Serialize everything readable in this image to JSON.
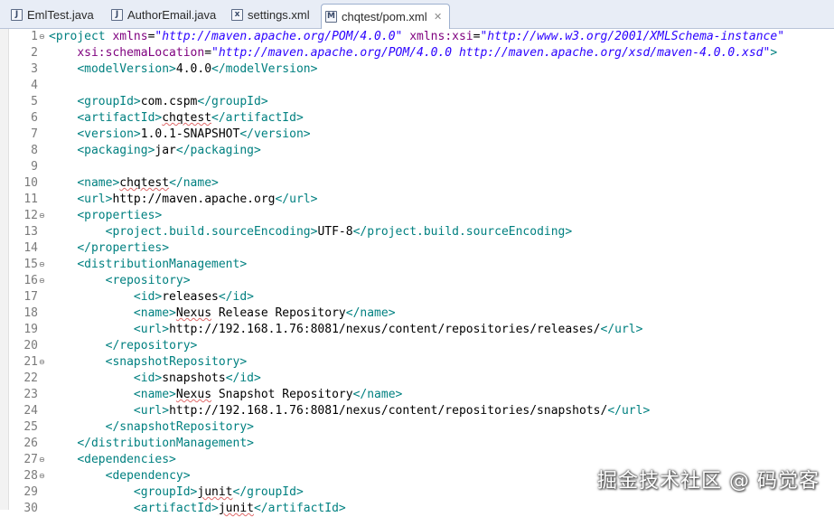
{
  "tabs": [
    {
      "label": "EmlTest.java",
      "icon": "java-file-icon",
      "glyph": "J",
      "active": false
    },
    {
      "label": "AuthorEmail.java",
      "icon": "java-file-icon",
      "glyph": "J",
      "active": false
    },
    {
      "label": "settings.xml",
      "icon": "xml-file-icon",
      "glyph": "x",
      "active": false
    },
    {
      "label": "chqtest/pom.xml",
      "icon": "maven-pom-icon",
      "glyph": "M",
      "active": true
    }
  ],
  "close_glyph": "✕",
  "editor": {
    "lines": [
      {
        "n": "1",
        "fold": true,
        "indent": "",
        "segs": [
          [
            "t",
            "<project "
          ],
          [
            "a",
            "xmlns"
          ],
          [
            "p",
            "="
          ],
          [
            "v",
            "\"http://maven.apache.org/POM/4.0.0\""
          ],
          [
            "p",
            " "
          ],
          [
            "a",
            "xmlns:xsi"
          ],
          [
            "p",
            "="
          ],
          [
            "v",
            "\"http://www.w3.org/2001/XMLSchema-instance\""
          ]
        ]
      },
      {
        "n": "2",
        "fold": false,
        "indent": "    ",
        "segs": [
          [
            "a",
            "xsi:schemaLocation"
          ],
          [
            "p",
            "="
          ],
          [
            "v",
            "\"http://maven.apache.org/POM/4.0.0 http://maven.apache.org/xsd/maven-4.0.0.xsd\""
          ],
          [
            "t",
            ">"
          ]
        ]
      },
      {
        "n": "3",
        "fold": false,
        "indent": "    ",
        "segs": [
          [
            "t",
            "<modelVersion>"
          ],
          [
            "p",
            "4.0.0"
          ],
          [
            "t",
            "</modelVersion>"
          ]
        ]
      },
      {
        "n": "4",
        "fold": false,
        "indent": "",
        "segs": []
      },
      {
        "n": "5",
        "fold": false,
        "indent": "    ",
        "segs": [
          [
            "t",
            "<groupId>"
          ],
          [
            "p",
            "com.cspm"
          ],
          [
            "t",
            "</groupId>"
          ]
        ]
      },
      {
        "n": "6",
        "fold": false,
        "indent": "    ",
        "segs": [
          [
            "t",
            "<artifactId>"
          ],
          [
            "s",
            "chqtest"
          ],
          [
            "t",
            "</artifactId>"
          ]
        ]
      },
      {
        "n": "7",
        "fold": false,
        "indent": "    ",
        "segs": [
          [
            "t",
            "<version>"
          ],
          [
            "p",
            "1.0.1-SNAPSHOT"
          ],
          [
            "t",
            "</version>"
          ]
        ]
      },
      {
        "n": "8",
        "fold": false,
        "indent": "    ",
        "segs": [
          [
            "t",
            "<packaging>"
          ],
          [
            "p",
            "jar"
          ],
          [
            "t",
            "</packaging>"
          ]
        ]
      },
      {
        "n": "9",
        "fold": false,
        "indent": "",
        "segs": []
      },
      {
        "n": "10",
        "fold": false,
        "indent": "    ",
        "segs": [
          [
            "t",
            "<name>"
          ],
          [
            "s",
            "chqtest"
          ],
          [
            "t",
            "</name>"
          ]
        ]
      },
      {
        "n": "11",
        "fold": false,
        "indent": "    ",
        "segs": [
          [
            "t",
            "<url>"
          ],
          [
            "p",
            "http://maven.apache.org"
          ],
          [
            "t",
            "</url>"
          ]
        ]
      },
      {
        "n": "12",
        "fold": true,
        "indent": "    ",
        "segs": [
          [
            "t",
            "<properties>"
          ]
        ]
      },
      {
        "n": "13",
        "fold": false,
        "indent": "        ",
        "segs": [
          [
            "t",
            "<project.build.sourceEncoding>"
          ],
          [
            "p",
            "UTF-8"
          ],
          [
            "t",
            "</project.build.sourceEncoding>"
          ]
        ]
      },
      {
        "n": "14",
        "fold": false,
        "indent": "    ",
        "segs": [
          [
            "t",
            "</properties>"
          ]
        ]
      },
      {
        "n": "15",
        "fold": true,
        "indent": "    ",
        "segs": [
          [
            "t",
            "<distributionManagement>"
          ]
        ]
      },
      {
        "n": "16",
        "fold": true,
        "indent": "        ",
        "segs": [
          [
            "t",
            "<repository>"
          ]
        ]
      },
      {
        "n": "17",
        "fold": false,
        "indent": "            ",
        "segs": [
          [
            "t",
            "<id>"
          ],
          [
            "p",
            "releases"
          ],
          [
            "t",
            "</id>"
          ]
        ]
      },
      {
        "n": "18",
        "fold": false,
        "indent": "            ",
        "segs": [
          [
            "t",
            "<name>"
          ],
          [
            "s",
            "Nexus"
          ],
          [
            "p",
            " Release Repository"
          ],
          [
            "t",
            "</name>"
          ]
        ]
      },
      {
        "n": "19",
        "fold": false,
        "indent": "            ",
        "segs": [
          [
            "t",
            "<url>"
          ],
          [
            "p",
            "http://192.168.1.76:8081/nexus/content/repositories/releases/"
          ],
          [
            "t",
            "</url>"
          ]
        ]
      },
      {
        "n": "20",
        "fold": false,
        "indent": "        ",
        "segs": [
          [
            "t",
            "</repository>"
          ]
        ]
      },
      {
        "n": "21",
        "fold": true,
        "indent": "        ",
        "segs": [
          [
            "t",
            "<snapshotRepository>"
          ]
        ]
      },
      {
        "n": "22",
        "fold": false,
        "indent": "            ",
        "segs": [
          [
            "t",
            "<id>"
          ],
          [
            "p",
            "snapshots"
          ],
          [
            "t",
            "</id>"
          ]
        ]
      },
      {
        "n": "23",
        "fold": false,
        "indent": "            ",
        "segs": [
          [
            "t",
            "<name>"
          ],
          [
            "s",
            "Nexus"
          ],
          [
            "p",
            " Snapshot Repository"
          ],
          [
            "t",
            "</name>"
          ]
        ]
      },
      {
        "n": "24",
        "fold": false,
        "indent": "            ",
        "segs": [
          [
            "t",
            "<url>"
          ],
          [
            "p",
            "http://192.168.1.76:8081/nexus/content/repositories/snapshots/"
          ],
          [
            "t",
            "</url>"
          ]
        ]
      },
      {
        "n": "25",
        "fold": false,
        "indent": "        ",
        "segs": [
          [
            "t",
            "</snapshotRepository>"
          ]
        ]
      },
      {
        "n": "26",
        "fold": false,
        "indent": "    ",
        "segs": [
          [
            "t",
            "</distributionManagement>"
          ]
        ]
      },
      {
        "n": "27",
        "fold": true,
        "indent": "    ",
        "segs": [
          [
            "t",
            "<dependencies>"
          ]
        ]
      },
      {
        "n": "28",
        "fold": true,
        "indent": "        ",
        "segs": [
          [
            "t",
            "<dependency>"
          ]
        ]
      },
      {
        "n": "29",
        "fold": false,
        "indent": "            ",
        "segs": [
          [
            "t",
            "<groupId>"
          ],
          [
            "s",
            "junit"
          ],
          [
            "t",
            "</groupId>"
          ]
        ]
      },
      {
        "n": "30",
        "fold": false,
        "indent": "            ",
        "segs": [
          [
            "t",
            "<artifactId>"
          ],
          [
            "s",
            "junit"
          ],
          [
            "t",
            "</artifactId>"
          ]
        ]
      }
    ]
  },
  "fold_glyph": "⊖",
  "watermark": "掘金技术社区 @ 码觉客",
  "colors": {
    "tag": "#008080",
    "attribute": "#7f007f",
    "attribute_value": "#2a00ff",
    "text": "#000000",
    "line_number": "#7b7b7b"
  }
}
